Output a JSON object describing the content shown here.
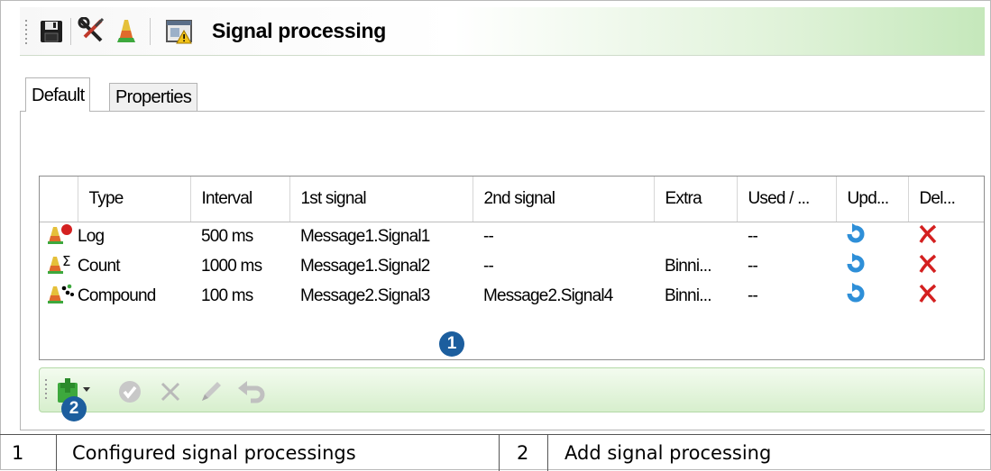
{
  "window": {
    "title": "Signal processing"
  },
  "toolbar": {
    "icons": [
      "save-icon",
      "tools-icon",
      "signal-processing-icon",
      "window-warning-icon"
    ]
  },
  "tabs": [
    {
      "label": "Default",
      "active": true
    },
    {
      "label": "Properties",
      "active": false
    }
  ],
  "grid": {
    "columns": [
      "Type",
      "Interval",
      "1st signal",
      "2nd signal",
      "Extra",
      "Used / ...",
      "Upd...",
      "Del..."
    ],
    "rows": [
      {
        "icon": "log-icon",
        "type": "Log",
        "interval": "500 ms",
        "signal1": "Message1.Signal1",
        "signal2": "--",
        "extra": "",
        "used": "--"
      },
      {
        "icon": "count-icon",
        "type": "Count",
        "interval": "1000 ms",
        "signal1": "Message1.Signal2",
        "signal2": "--",
        "extra": "Binni...",
        "used": "--"
      },
      {
        "icon": "compound-icon",
        "type": "Compound",
        "interval": "100 ms",
        "signal1": "Message2.Signal3",
        "signal2": "Message2.Signal4",
        "extra": "Binni...",
        "used": "--"
      }
    ]
  },
  "callouts": {
    "one": "1",
    "two": "2"
  },
  "action_bar": {
    "icons": [
      "add-dropdown-icon",
      "apply-icon",
      "cancel-icon",
      "edit-icon",
      "undo-icon"
    ]
  },
  "legend": [
    {
      "number": "1",
      "text": "Configured signal processings"
    },
    {
      "number": "2",
      "text": "Add signal processing"
    }
  ],
  "colors": {
    "accent_green": "#c5e8bb",
    "callout_blue": "#1c5e9e",
    "delete_red": "#d42020",
    "update_blue": "#2e8fd8"
  }
}
